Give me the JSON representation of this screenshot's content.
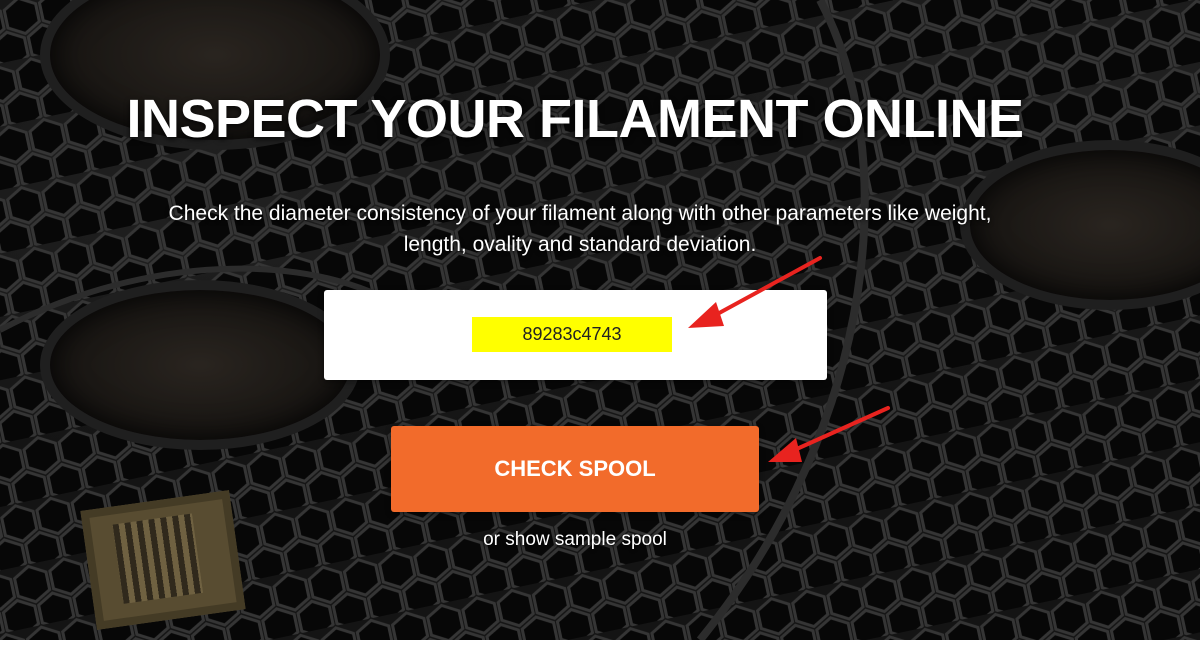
{
  "hero": {
    "title": "INSPECT YOUR FILAMENT ONLINE",
    "subtitle_line1": "Check the diameter consistency of your filament along with other parameters like weight,",
    "subtitle_line2": "length, ovality and standard deviation."
  },
  "form": {
    "spool_code_value": "89283c4743",
    "check_button_label": "CHECK SPOOL",
    "sample_link_label": "or show sample spool"
  },
  "annotations": {
    "arrow_color": "#e8231f",
    "highlight_color": "#ffff00"
  },
  "colors": {
    "button": "#f26b2b",
    "background": "#1c1c1c"
  },
  "icons": [
    "annotation-arrow-icon",
    "annotation-arrow-icon"
  ]
}
